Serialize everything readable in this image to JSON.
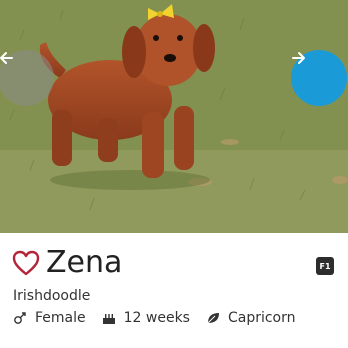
{
  "listing": {
    "name": "Zena",
    "badge": "F1",
    "breed": "Irishdoodle",
    "gender": "Female",
    "age": "12 weeks",
    "zodiac": "Capricorn"
  },
  "icons": {
    "prev": "arrow-left-icon",
    "next": "arrow-right-icon",
    "favorite": "heart-icon",
    "gender": "gender-icon",
    "age": "cake-icon",
    "zodiac": "leaf-icon"
  },
  "colors": {
    "accent": "#1a9bd7",
    "heart": "#b3263a",
    "badge_bg": "#2d2d2d"
  }
}
